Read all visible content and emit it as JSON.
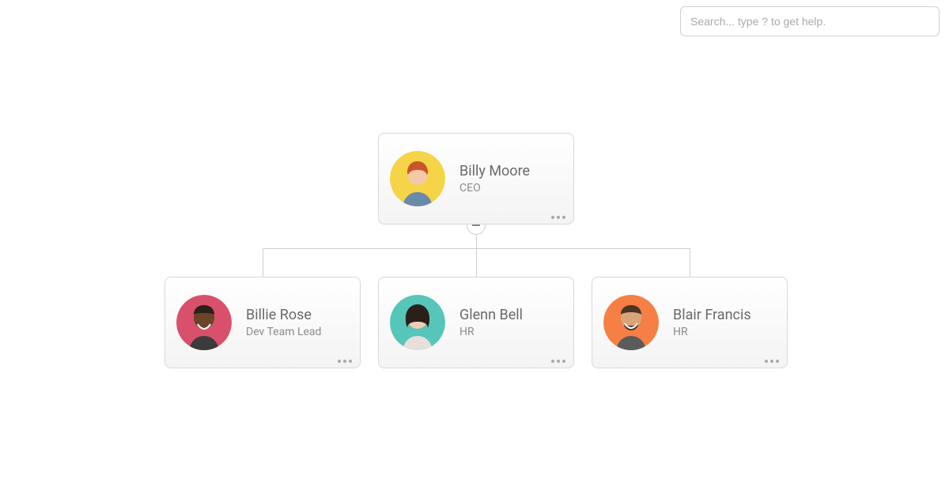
{
  "search": {
    "placeholder": "Search... type ? to get help."
  },
  "nodes": {
    "ceo": {
      "name": "Billy Moore",
      "title": "CEO",
      "avatar_bg": "#f6d447"
    },
    "child1": {
      "name": "Billie Rose",
      "title": "Dev Team Lead",
      "avatar_bg": "#d8506b"
    },
    "child2": {
      "name": "Glenn Bell",
      "title": "HR",
      "avatar_bg": "#55c6b9"
    },
    "child3": {
      "name": "Blair Francis",
      "title": "HR",
      "avatar_bg": "#f57f44"
    }
  }
}
